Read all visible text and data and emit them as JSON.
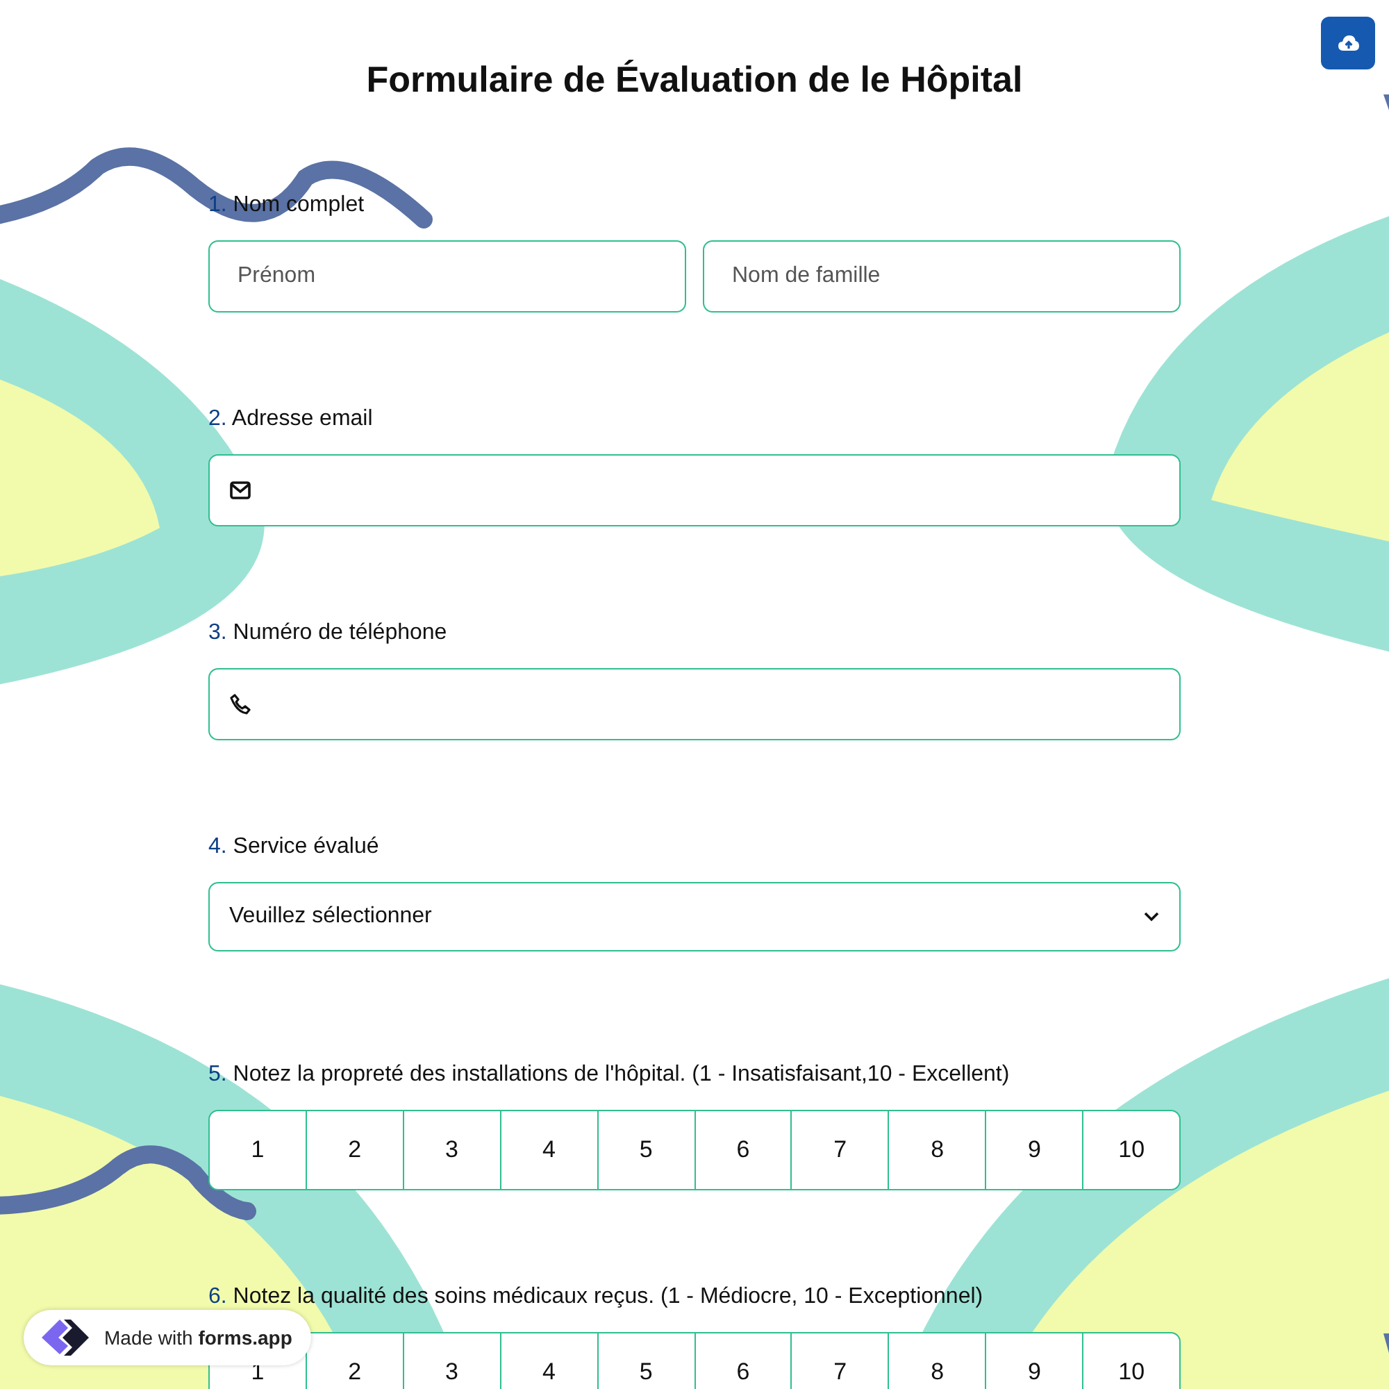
{
  "title": "Formulaire de Évaluation de le Hôpital",
  "questions": [
    {
      "kind": "name",
      "number": "1.",
      "label": "Nom complet",
      "fields": [
        {
          "placeholder": "Prénom"
        },
        {
          "placeholder": "Nom de famille"
        }
      ]
    },
    {
      "kind": "email",
      "number": "2.",
      "label": "Adresse email"
    },
    {
      "kind": "phone",
      "number": "3.",
      "label": "Numéro de téléphone"
    },
    {
      "kind": "select",
      "number": "4.",
      "label": "Service évalué",
      "value": "Veuillez sélectionner"
    },
    {
      "kind": "rating",
      "number": "5.",
      "label": "Notez la propreté des installations de l'hôpital. (1 - Insatisfaisant,10 - Excellent)",
      "options": [
        {
          "label": "1",
          "selected": false
        },
        {
          "label": "2",
          "selected": false
        },
        {
          "label": "3",
          "selected": false
        },
        {
          "label": "4",
          "selected": false
        },
        {
          "label": "5",
          "selected": false
        },
        {
          "label": "6",
          "selected": false
        },
        {
          "label": "7",
          "selected": false
        },
        {
          "label": "8",
          "selected": false
        },
        {
          "label": "9",
          "selected": false
        },
        {
          "label": "10",
          "selected": false
        }
      ]
    },
    {
      "kind": "rating",
      "number": "6.",
      "label": "Notez la qualité des soins médicaux reçus. (1 - Médiocre, 10 - Exceptionnel)",
      "options": [
        {
          "label": "1",
          "selected": false
        },
        {
          "label": "2",
          "selected": false
        },
        {
          "label": "3",
          "selected": false
        },
        {
          "label": "4",
          "selected": false
        },
        {
          "label": "5",
          "selected": false
        },
        {
          "label": "6",
          "selected": false
        },
        {
          "label": "7",
          "selected": false
        },
        {
          "label": "8",
          "selected": false
        },
        {
          "label": "9",
          "selected": false
        },
        {
          "label": "10",
          "selected": false
        }
      ]
    }
  ],
  "badge": "Made with **forms.app**"
}
